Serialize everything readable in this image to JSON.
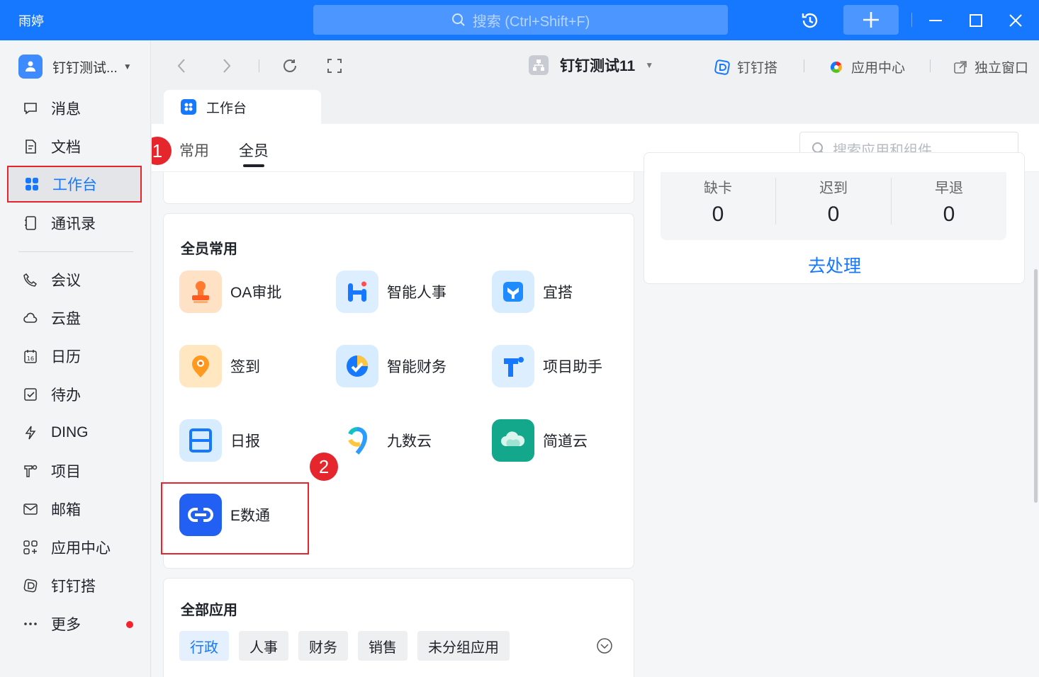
{
  "app": {
    "name": "雨婷"
  },
  "titlebar": {
    "search_placeholder": "搜索 (Ctrl+Shift+F)"
  },
  "sidebar": {
    "org_name": "钉钉测试...",
    "items": [
      {
        "label": "消息"
      },
      {
        "label": "文档"
      },
      {
        "label": "工作台"
      },
      {
        "label": "通讯录"
      },
      {
        "label": "会议"
      },
      {
        "label": "云盘"
      },
      {
        "label": "日历"
      },
      {
        "label": "待办"
      },
      {
        "label": "DING"
      },
      {
        "label": "项目"
      },
      {
        "label": "邮箱"
      },
      {
        "label": "应用中心"
      },
      {
        "label": "钉钉搭"
      },
      {
        "label": "更多"
      }
    ],
    "calendar_day": "16"
  },
  "toolbar": {
    "workspace_title": "钉钉测试11",
    "links": [
      {
        "label": "钉钉搭"
      },
      {
        "label": "应用中心"
      },
      {
        "label": "独立窗口"
      }
    ]
  },
  "tab": {
    "label": "工作台"
  },
  "subtabs": {
    "common": "常用",
    "all": "全员"
  },
  "annotations": {
    "marker1": "1",
    "marker2": "2"
  },
  "app_search": {
    "placeholder": "搜索应用和组件"
  },
  "common_apps": {
    "title": "全员常用",
    "apps": [
      {
        "name": "OA审批"
      },
      {
        "name": "智能人事"
      },
      {
        "name": "宜搭"
      },
      {
        "name": "签到"
      },
      {
        "name": "智能财务"
      },
      {
        "name": "项目助手"
      },
      {
        "name": "日报"
      },
      {
        "name": "九数云"
      },
      {
        "name": "简道云"
      },
      {
        "name": "E数通"
      }
    ]
  },
  "all_apps": {
    "title": "全部应用",
    "categories": [
      {
        "label": "行政"
      },
      {
        "label": "人事"
      },
      {
        "label": "财务"
      },
      {
        "label": "销售"
      },
      {
        "label": "未分组应用"
      }
    ]
  },
  "attendance": {
    "stats": [
      {
        "label": "缺卡",
        "value": "0"
      },
      {
        "label": "迟到",
        "value": "0"
      },
      {
        "label": "早退",
        "value": "0"
      }
    ],
    "action": "去处理"
  },
  "colors": {
    "brand": "#1677ff",
    "highlight": "#e5262c"
  }
}
